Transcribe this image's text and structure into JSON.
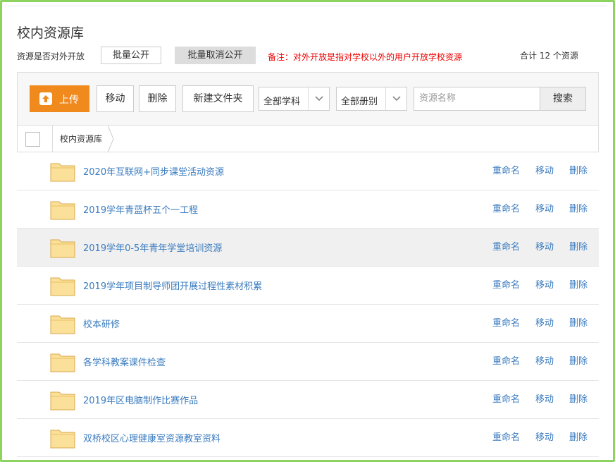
{
  "header": {
    "title": "校内资源库",
    "open_label": "资源是否对外开放",
    "batch_public": "批量公开",
    "batch_unpublic": "批量取消公开",
    "note": "备注：对外开放是指对学校以外的用户开放学校资源",
    "total": "合计 12 个资源"
  },
  "toolbar": {
    "upload": "上传",
    "move": "移动",
    "delete": "删除",
    "new_folder": "新建文件夹",
    "subject_select": "全部学科",
    "volume_select": "全部册别",
    "search_placeholder": "资源名称",
    "search_button": "搜索"
  },
  "breadcrumb": {
    "root": "校内资源库"
  },
  "actions": {
    "rename": "重命名",
    "move": "移动",
    "delete": "删除"
  },
  "colors": {
    "accent": "#f18a1d",
    "link": "#3a7bbf",
    "note": "#ee0000",
    "frame": "#8dd35f",
    "folder": "#fbe09a"
  },
  "items": [
    {
      "name": "2020年互联网+同步课堂活动资源"
    },
    {
      "name": "2019学年青蓝杯五个一工程"
    },
    {
      "name": "2019学年0-5年青年学堂培训资源"
    },
    {
      "name": "2019学年项目制导师团开展过程性素材积累"
    },
    {
      "name": "校本研修"
    },
    {
      "name": "各学科教案课件检查"
    },
    {
      "name": "2019年区电脑制作比赛作品"
    },
    {
      "name": "双桥校区心理健康室资源教室资料"
    }
  ]
}
